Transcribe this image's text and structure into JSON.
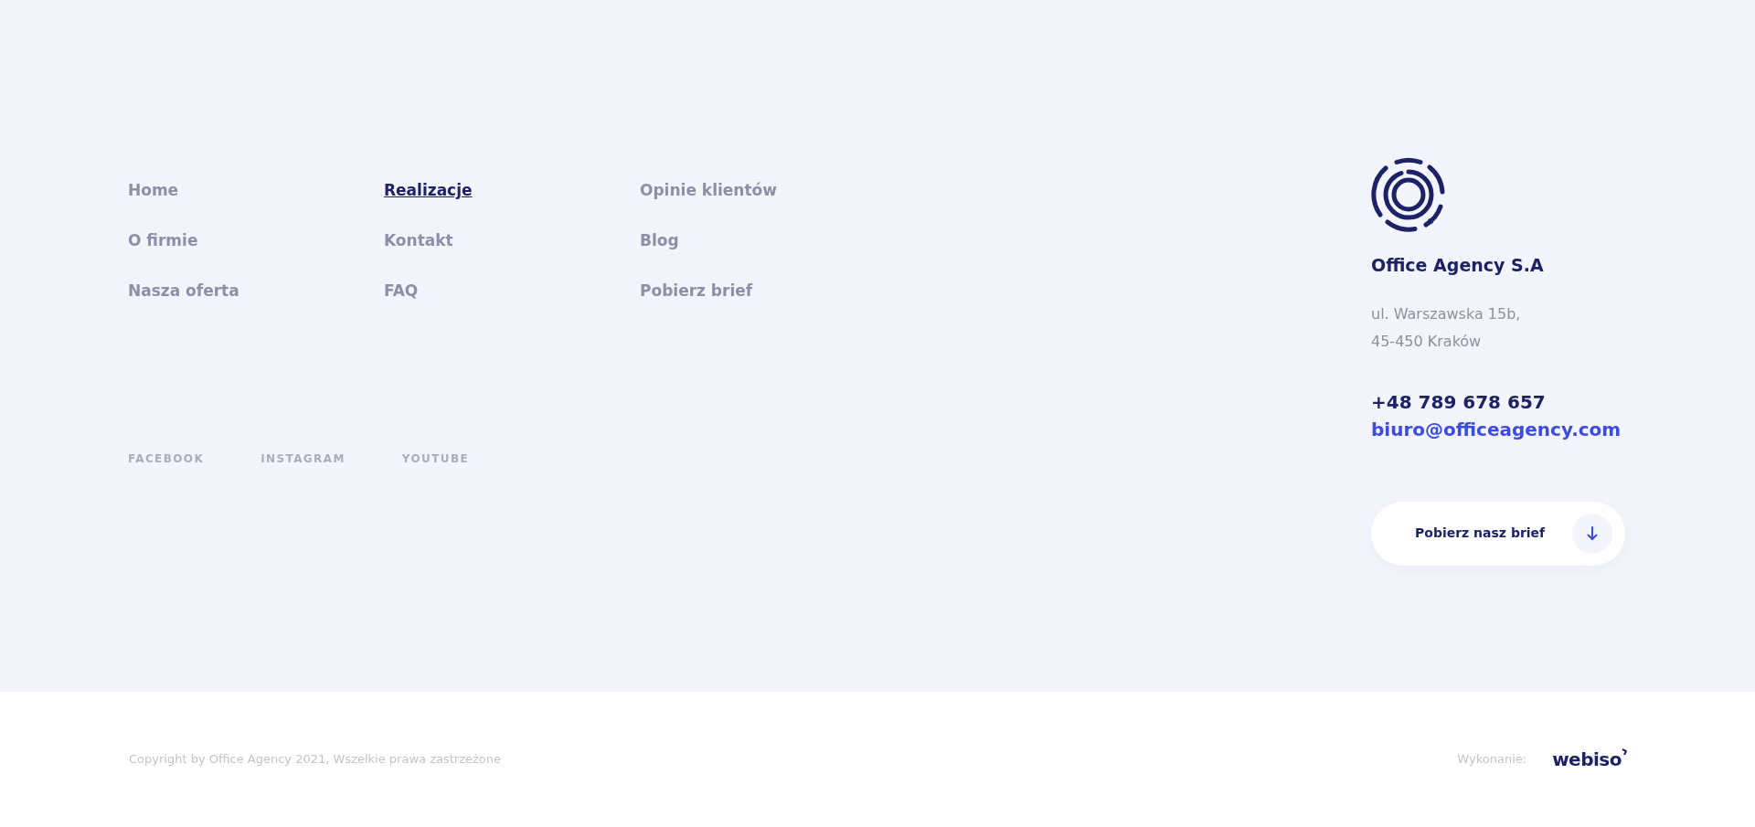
{
  "nav_links": [
    {
      "label": "Home",
      "hovered": false
    },
    {
      "label": "Realizacje",
      "hovered": true
    },
    {
      "label": "Opinie klientów",
      "hovered": false
    },
    {
      "label": "O firmie",
      "hovered": false
    },
    {
      "label": "Kontakt",
      "hovered": false
    },
    {
      "label": "Blog",
      "hovered": false
    },
    {
      "label": "Nasza oferta",
      "hovered": false
    },
    {
      "label": "FAQ",
      "hovered": false
    },
    {
      "label": "Pobierz brief",
      "hovered": false
    }
  ],
  "social_links": [
    "FACEBOOK",
    "INSTAGRAM",
    "YOUTUBE"
  ],
  "company": {
    "name": "Office Agency S.A",
    "address": [
      "ul. Warszawska 15b,",
      "45-450 Kraków"
    ],
    "phone": "+48 789 678 657",
    "email": "biuro@officeagency.com"
  },
  "brief_button": {
    "label": "Pobierz nasz brief"
  },
  "bottom_bar": {
    "copyright": "Copyright by Office Agency 2021, Wszelkie prawa zastrzeżone",
    "credit_label": "Wykonanie:",
    "credit_logo": "webiso"
  }
}
